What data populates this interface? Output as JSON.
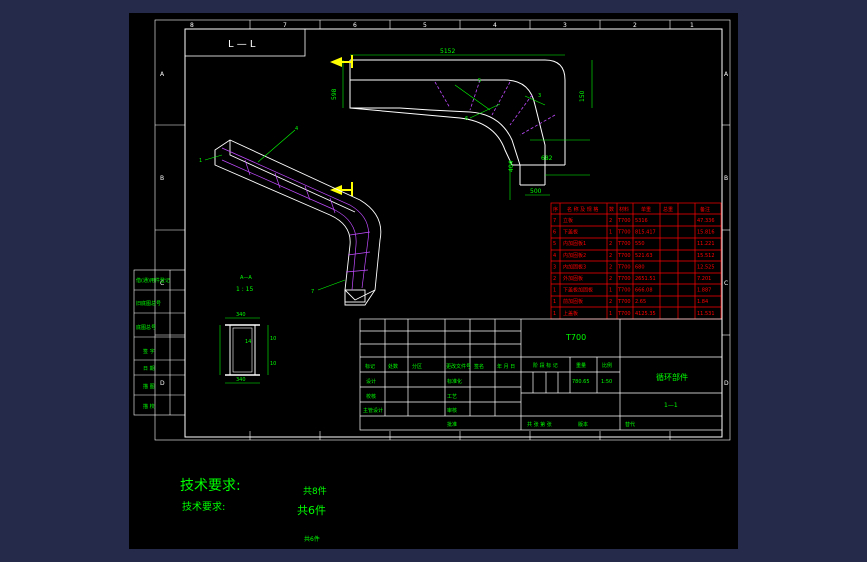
{
  "colors": {
    "background": "#25294a",
    "paper": "#000000",
    "frame": "#ffffff",
    "text_green": "#00ff00",
    "dimension": "#00ff00",
    "table_red": "#ff0000",
    "magenta": "#c14bff",
    "yellow": "#ffff00"
  },
  "view": {
    "section_label": "L — L",
    "detail_label": "A—A",
    "detail_scale": "1 : 15"
  },
  "grid_labels": {
    "top": [
      "8",
      "7",
      "6",
      "5",
      "4",
      "3",
      "2",
      "1"
    ],
    "left": [
      "A",
      "B",
      "C",
      "D"
    ],
    "right": [
      "A",
      "B",
      "C",
      "D"
    ]
  },
  "dimensions": {
    "length": "5152",
    "left_height": "598",
    "right_height": "150",
    "radius": "682",
    "vertical": "404",
    "bottom": "500",
    "det_width_top": "340",
    "det_width_bottom": "340",
    "det_inner": "14",
    "det_side_1": "10",
    "det_side_2": "10"
  },
  "balloons": [
    "1",
    "2",
    "3",
    "4",
    "5",
    "6",
    "7"
  ],
  "parts_table": {
    "headers": [
      "序",
      "名 称 及 规 格",
      "数",
      "材料",
      "单重",
      "总重",
      "备注"
    ],
    "rows": [
      [
        "7",
        "立板",
        "2",
        "T700",
        "5316",
        "",
        "47.336"
      ],
      [
        "6",
        "下盖板",
        "1",
        "T700",
        "815.417",
        "",
        "15.816"
      ],
      [
        "5",
        "内加固板1",
        "2",
        "T700",
        "550",
        "",
        "11.221"
      ],
      [
        "4",
        "内加固板2",
        "2",
        "T700",
        "521.63",
        "",
        "15.512"
      ],
      [
        "3",
        "内加固板3",
        "2",
        "T700",
        "680",
        "",
        "12.525"
      ],
      [
        "2",
        "外加固板",
        "2",
        "T700",
        "2651.51",
        "",
        "7.201"
      ],
      [
        "1",
        "下盖板加固板",
        "1",
        "T700",
        "666.08",
        "",
        "1.887"
      ],
      [
        "1",
        "前加固板",
        "2",
        "T700",
        "2.65",
        "",
        "1.84"
      ],
      [
        "1",
        "上盖板",
        "1",
        "T700",
        "4125.35",
        "",
        "11.531"
      ]
    ]
  },
  "title_block": {
    "material": "T700",
    "drawing_name": "循环部件",
    "drawing_code": "1—1",
    "weight": "780.65",
    "scale": "1:50",
    "h_marks": "标记",
    "h_count": "处数",
    "h_zone": "分区",
    "h_doc": "更改文件号",
    "h_sign": "签名",
    "h_date": "年 月 日",
    "h_stage": "阶 段 标 记",
    "h_weight": "重量",
    "h_scale": "比例",
    "r_design": "设计",
    "r_check": "校核",
    "r_process": "主管设计",
    "r_standard": "标准化",
    "r_tech": "工艺",
    "r_audit": "审核",
    "r_approve": "批准",
    "sheets": "共 张  第 张",
    "version": "版本",
    "replace": "替代"
  },
  "side_block": [
    "借(通)用件登记",
    "旧底图总号",
    "底图总号",
    "签 字",
    "日 期",
    "描 图",
    "描 校"
  ],
  "notes": {
    "title_big": "技术要求:",
    "title_small": "技术要求:",
    "line1": "共8件",
    "line2": "共6件",
    "line3": "共6件"
  }
}
